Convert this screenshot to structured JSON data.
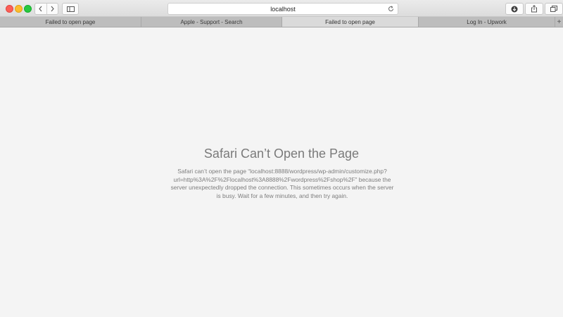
{
  "toolbar": {
    "url": "localhost",
    "traffic_lights": {
      "close_color": "#fc5f57",
      "minimize_color": "#fdbc2e",
      "maximize_color": "#28c840"
    }
  },
  "tabs": [
    {
      "label": "Failed to open page",
      "active": false
    },
    {
      "label": "Apple - Support - Search",
      "active": false
    },
    {
      "label": "Failed to open page",
      "active": true
    },
    {
      "label": "Log In - Upwork",
      "active": false
    }
  ],
  "new_tab_label": "+",
  "icons": {
    "back": "chevron-left-icon",
    "forward": "chevron-right-icon",
    "sidebar": "sidebar-icon",
    "reload": "reload-icon",
    "download": "download-icon",
    "share": "share-icon",
    "tab_overview": "tab-overview-icon"
  },
  "error": {
    "title": "Safari Can’t Open the Page",
    "message_lines": [
      "Safari can’t open the page “localhost:8888/wordpress/wp-admin/customize.php?",
      "url=http%3A%2F%2Flocalhost%3A8888%2Fwordpress%2Fshop%2F” because the",
      "server unexpectedly dropped the connection. This sometimes occurs when the server",
      "is busy. Wait for a few minutes, and then try again."
    ]
  }
}
